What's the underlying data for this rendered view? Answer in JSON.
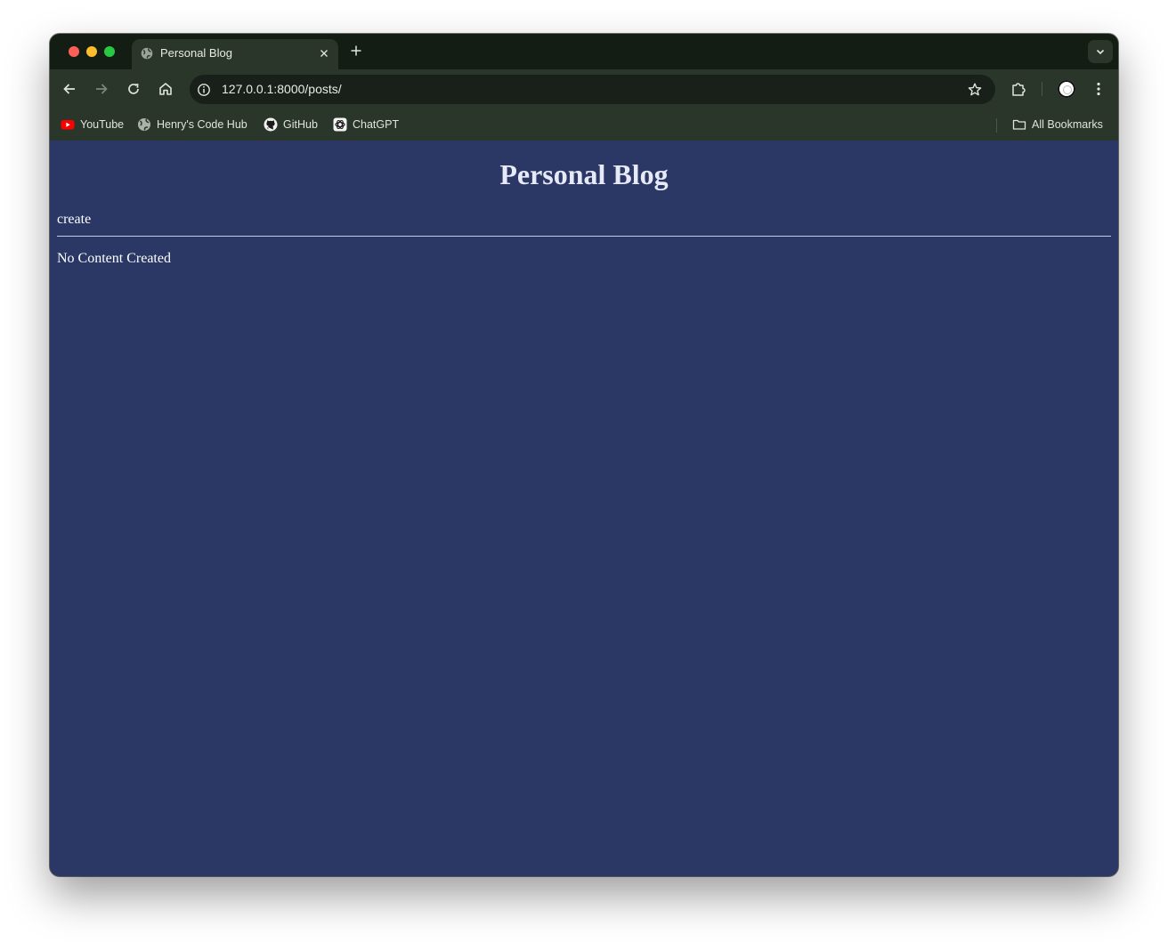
{
  "browser": {
    "tab": {
      "title": "Personal Blog"
    },
    "url": "127.0.0.1:8000/posts/",
    "bookmarks": [
      {
        "label": "YouTube",
        "icon": "youtube-icon"
      },
      {
        "label": "Henry's Code Hub",
        "icon": "globe-icon"
      },
      {
        "label": "GitHub",
        "icon": "github-icon"
      },
      {
        "label": "ChatGPT",
        "icon": "chatgpt-icon"
      }
    ],
    "all_bookmarks_label": "All Bookmarks",
    "colors": {
      "frame": "#131d13",
      "toolbar": "#2a362a",
      "omnibox": "#192019"
    }
  },
  "page": {
    "title": "Personal Blog",
    "create_link": "create",
    "empty_message": "No Content Created",
    "colors": {
      "background": "#2b3865",
      "text": "#ffffff"
    }
  }
}
